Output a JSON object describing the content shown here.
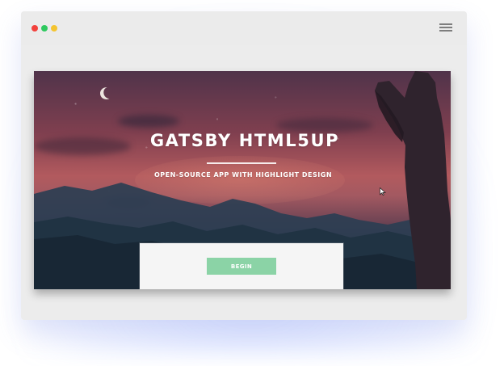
{
  "window": {
    "traffic_lights": [
      {
        "name": "close",
        "color": "#f2413c"
      },
      {
        "name": "maximize",
        "color": "#2ec95f"
      },
      {
        "name": "minimize",
        "color": "#f4c430"
      }
    ],
    "menu_icon": "hamburger-menu-icon"
  },
  "hero": {
    "title": "GATSBY HTML5UP",
    "subtitle": "OPEN-SOURCE APP WITH HIGHLIGHT DESIGN"
  },
  "card": {
    "button_label": "BEGIN"
  },
  "colors": {
    "accent": "#8bd3a6",
    "title_text": "#ffffff",
    "window_bg": "#ececec",
    "card_bg": "#f5f5f5"
  }
}
